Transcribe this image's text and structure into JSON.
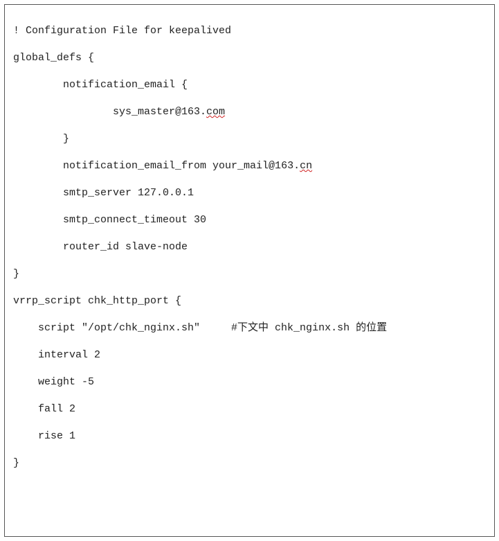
{
  "code": {
    "l1": "! Configuration File for keepalived",
    "l2": "global_defs {",
    "l3": "        notification_email {",
    "l4": "                sys_master@163.",
    "l4err": "com",
    "l5": "        }",
    "l6": "",
    "l7a": "        notification_email_from your_mail@163.",
    "l7err": "cn",
    "l8": "        smtp_server 127.0.0.1",
    "l9": "        smtp_connect_timeout 30",
    "l10": "        router_id slave-node",
    "l11": "}",
    "l12": "",
    "l13": "vrrp_script chk_http_port {",
    "l14": "    script \"/opt/chk_nginx.sh\"     #下文中 chk_nginx.sh 的位置",
    "l15": "    interval 2",
    "l16": "    weight -5",
    "l17": "    fall 2",
    "l18": "    rise 1",
    "l19": "}"
  }
}
